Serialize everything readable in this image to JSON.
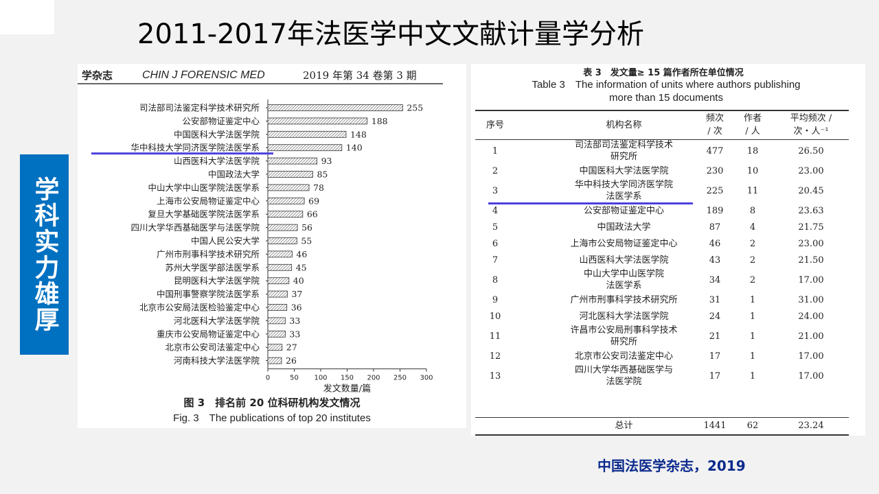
{
  "slide": {
    "title": "2011-2017年法医学中文文献计量学分析",
    "side_label": "学科实力雄厚",
    "source_note": "中国法医学杂志，2019"
  },
  "figure": {
    "journal_header_left": "学杂志",
    "journal_header_mid": "CHIN J FORENSIC MED",
    "journal_header_right": "2019 年第 34 卷第 3 期",
    "caption_cn": "图 3　排名前 20 位科研机构发文情况",
    "caption_en": "Fig. 3　The publications of top 20 institutes"
  },
  "chart_data": {
    "type": "bar",
    "orientation": "horizontal",
    "title": "",
    "xlabel": "发文数量/篇",
    "ylabel": "",
    "xlim": [
      0,
      300
    ],
    "xticks": [
      0,
      50,
      100,
      150,
      200,
      250,
      300
    ],
    "categories": [
      "司法部司法鉴定科学技术研究所",
      "公安部物证鉴定中心",
      "中国医科大学法医学院",
      "华中科技大学同济医学院法医学系",
      "山西医科大学法医学院",
      "中国政法大学",
      "中山大学中山医学院法医学系",
      "上海市公安局物证鉴定中心",
      "复旦大学基础医学院法医学系",
      "四川大学华西基础医学与法医学院",
      "中国人民公安大学",
      "广州市刑事科学技术研究所",
      "苏州大学医学部法医学系",
      "昆明医科大学法医学院",
      "中国刑事警察学院法医学系",
      "北京市公安局法医检验鉴定中心",
      "河北医科大学法医学院",
      "重庆市公安局物证鉴定中心",
      "北京市公安司法鉴定中心",
      "河南科技大学法医学院"
    ],
    "values": [
      255,
      188,
      148,
      140,
      93,
      85,
      78,
      69,
      66,
      56,
      55,
      46,
      45,
      40,
      37,
      36,
      33,
      33,
      27,
      26
    ],
    "highlighted_category": "华中科技大学同济医学院法医学系",
    "highlight_color": "#4b3fdc",
    "bar_fill": "hatched-gray"
  },
  "table": {
    "title_cn": "表 3　发文量≥ 15 篇作者所在单位情况",
    "title_en_line1": "Table 3　The information of units where authors publishing",
    "title_en_line2": "more than 15 documents",
    "headers": {
      "no": "序号",
      "name": "机构名称",
      "freq_line1": "频次",
      "freq_line2": "/ 次",
      "auth_line1": "作者",
      "auth_line2": "/ 人",
      "avg_line1": "平均频次 /",
      "avg_line2": "次・人⁻¹"
    },
    "rows": [
      {
        "no": "1",
        "name_line1": "司法部司法鉴定科学技术",
        "name_line2": "研究所",
        "freq": "477",
        "authors": "18",
        "avg": "26.50"
      },
      {
        "no": "2",
        "name_line1": "中国医科大学法医学院",
        "name_line2": "",
        "freq": "230",
        "authors": "10",
        "avg": "23.00"
      },
      {
        "no": "3",
        "name_line1": "华中科技大学同济医学院",
        "name_line2": "法医学系",
        "freq": "225",
        "authors": "11",
        "avg": "20.45"
      },
      {
        "no": "4",
        "name_line1": "公安部物证鉴定中心",
        "name_line2": "",
        "freq": "189",
        "authors": "8",
        "avg": "23.63"
      },
      {
        "no": "5",
        "name_line1": "中国政法大学",
        "name_line2": "",
        "freq": "87",
        "authors": "4",
        "avg": "21.75"
      },
      {
        "no": "6",
        "name_line1": "上海市公安局物证鉴定中心",
        "name_line2": "",
        "freq": "46",
        "authors": "2",
        "avg": "23.00"
      },
      {
        "no": "7",
        "name_line1": "山西医科大学法医学院",
        "name_line2": "",
        "freq": "43",
        "authors": "2",
        "avg": "21.50"
      },
      {
        "no": "8",
        "name_line1": "中山大学中山医学院",
        "name_line2": "法医学系",
        "freq": "34",
        "authors": "2",
        "avg": "17.00"
      },
      {
        "no": "9",
        "name_line1": "广州市刑事科学技术研究所",
        "name_line2": "",
        "freq": "31",
        "authors": "1",
        "avg": "31.00"
      },
      {
        "no": "10",
        "name_line1": "河北医科大学法医学院",
        "name_line2": "",
        "freq": "24",
        "authors": "1",
        "avg": "24.00"
      },
      {
        "no": "11",
        "name_line1": "许昌市公安局刑事科学技术",
        "name_line2": "研究所",
        "freq": "21",
        "authors": "1",
        "avg": "21.00"
      },
      {
        "no": "12",
        "name_line1": "北京市公安司法鉴定中心",
        "name_line2": "",
        "freq": "17",
        "authors": "1",
        "avg": "17.00"
      },
      {
        "no": "13",
        "name_line1": "四川大学华西基础医学与",
        "name_line2": "法医学院",
        "freq": "17",
        "authors": "1",
        "avg": "17.00"
      }
    ],
    "total": {
      "label": "总计",
      "freq": "1441",
      "authors": "62",
      "avg": "23.24"
    },
    "highlighted_row": "3"
  },
  "colors": {
    "side_label_bg": "#0070c0",
    "source_note": "#0b2a8c",
    "highlight_underline": "#4b3fdc"
  }
}
